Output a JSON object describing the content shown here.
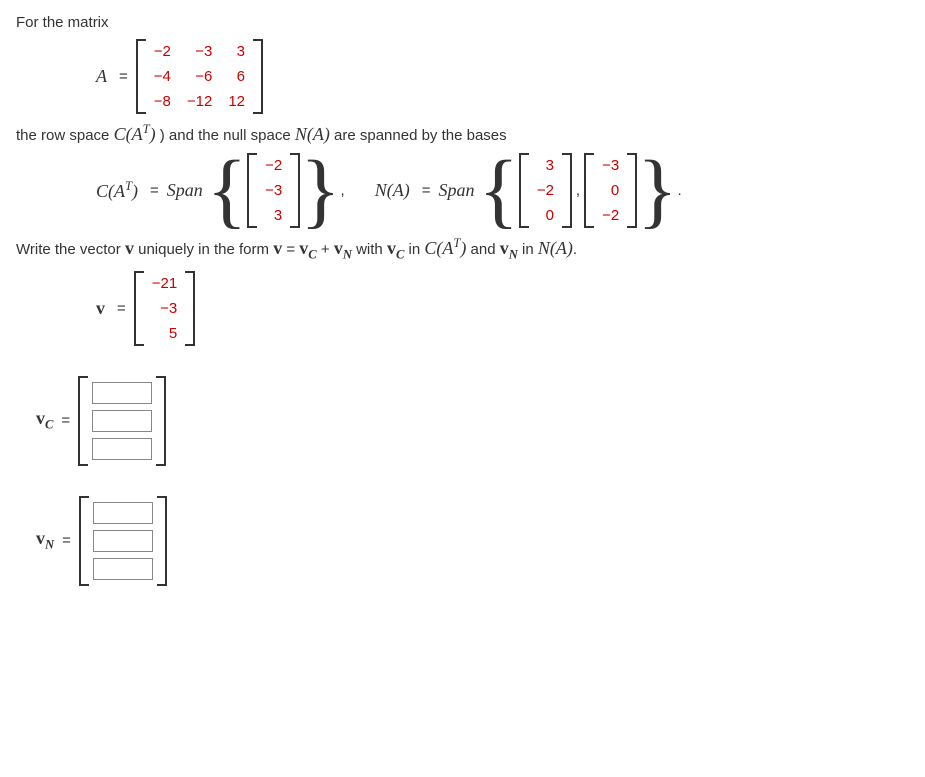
{
  "intro": "For the matrix",
  "matrix_A_label": "A",
  "matrix_A": [
    [
      "−2",
      "−3",
      "3"
    ],
    [
      "−4",
      "−6",
      "6"
    ],
    [
      "−8",
      "−12",
      "12"
    ]
  ],
  "line2_pre": "the row space ",
  "CAT": "C(A",
  "T": "T",
  "line2_mid": ") and the null space ",
  "NA": "N(A)",
  "line2_post": " are spanned by the bases",
  "span_word": "Span",
  "basis_CAT": [
    [
      "−2"
    ],
    [
      "−3"
    ],
    [
      "3"
    ]
  ],
  "basis_NA_1": [
    [
      "3"
    ],
    [
      "−2"
    ],
    [
      "0"
    ]
  ],
  "basis_NA_2": [
    [
      "−3"
    ],
    [
      "0"
    ],
    [
      "−2"
    ]
  ],
  "line3_pre": "Write the vector ",
  "v": "v",
  "line3_mid1": " uniquely in the form ",
  "eq_form": "v = v",
  "sub_C": "C",
  "plus": " + ",
  "sub_N": "N",
  "line3_mid2": " with ",
  "line3_in": " in ",
  "line3_and": " and ",
  "period": ".",
  "comma": ",",
  "vec_v": [
    [
      "−21"
    ],
    [
      "−3"
    ],
    [
      "5"
    ]
  ],
  "vc_label": "v",
  "vn_label": "v",
  "equals": "="
}
